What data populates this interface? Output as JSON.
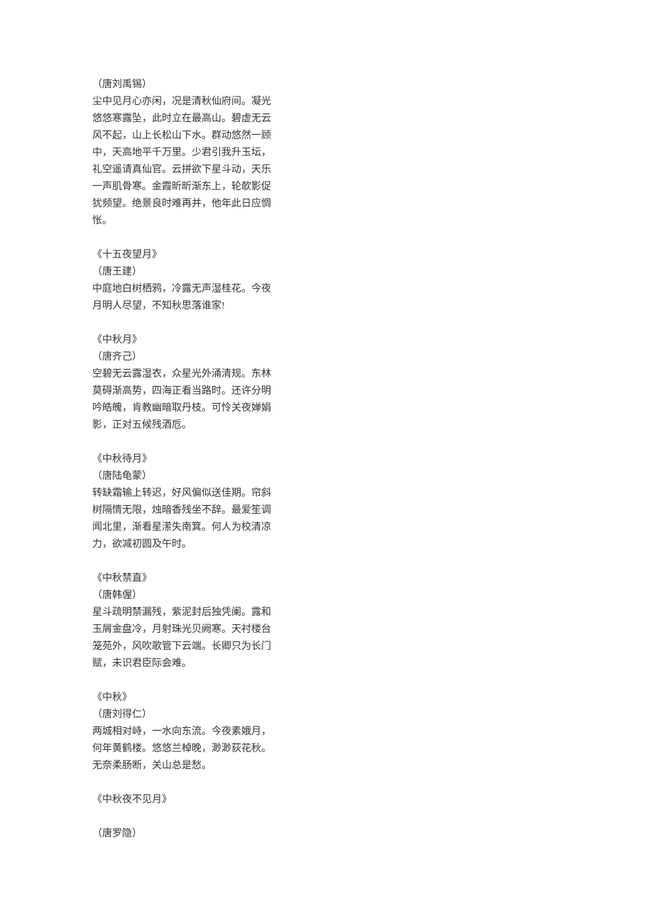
{
  "poems": [
    {
      "author": "（唐刘禹锡）",
      "body_lines": [
        "尘中见月心亦闲，况是清秋仙府间。凝光",
        "悠悠寒露坠，此时立在最高山。碧虚无云",
        "风不起，山上长松山下水。群动悠然一顾",
        "中，天高地平千万里。少君引我升玉坛，",
        "礼空遥请真仙官。云拼欲下星斗动，天乐",
        "一声肌骨寒。金霞昕昕渐东上，轮欹影促",
        "犹频望。绝景良时难再并，他年此日应惆",
        "怅。"
      ]
    },
    {
      "title": "《十五夜望月》",
      "author": "（唐王建）",
      "body_lines": [
        "中庭地白树栖鸦，冷露无声湿桂花。今夜",
        "月明人尽望，不知秋思落谁家!"
      ]
    },
    {
      "title": "《中秋月》",
      "author": "（唐齐己）",
      "body_lines": [
        "空碧无云露湿衣，众星光外涌清规。东林",
        "莫碍渐高势，四海正看当路时。还许分明",
        "吟皓魄，肯教幽暗取丹枝。可怜关夜婵娟",
        "影，正对五候残酒卮。"
      ]
    },
    {
      "title": "《中秋待月》",
      "author": "（唐陆龟蒙）",
      "body_lines": [
        "转缺霜输上转迟，好风偏似送佳期。帘斜",
        "树隔情无限，烛暗香残坐不辞。最爱笙调",
        "闻北里，渐看星潆失南箕。何人为校清凉",
        "力，欲减初圆及午时。"
      ]
    },
    {
      "title": "《中秋禁直》",
      "author": "（唐韩偓）",
      "body_lines": [
        "星斗疏明禁漏残，紫泥封后独凭阑。露和",
        "玉屑金盘冷，月射珠光贝阙寒。天衬楼台",
        "笼苑外，风吹歌管下云端。长卿只为长门",
        "赋，未识君臣际会难。"
      ]
    },
    {
      "title": "《中秋》",
      "author": "（唐刘得仁）",
      "body_lines": [
        "两城相对峙，一水向东流。今夜素娥月，",
        "何年黄鹤楼。悠悠兰棹晚，渺渺荻花秋。",
        "无奈柔肠断，关山总是愁。"
      ]
    },
    {
      "title": "《中秋夜不见月》",
      "gap_after_title": true,
      "author": "（唐罗隐）"
    }
  ]
}
